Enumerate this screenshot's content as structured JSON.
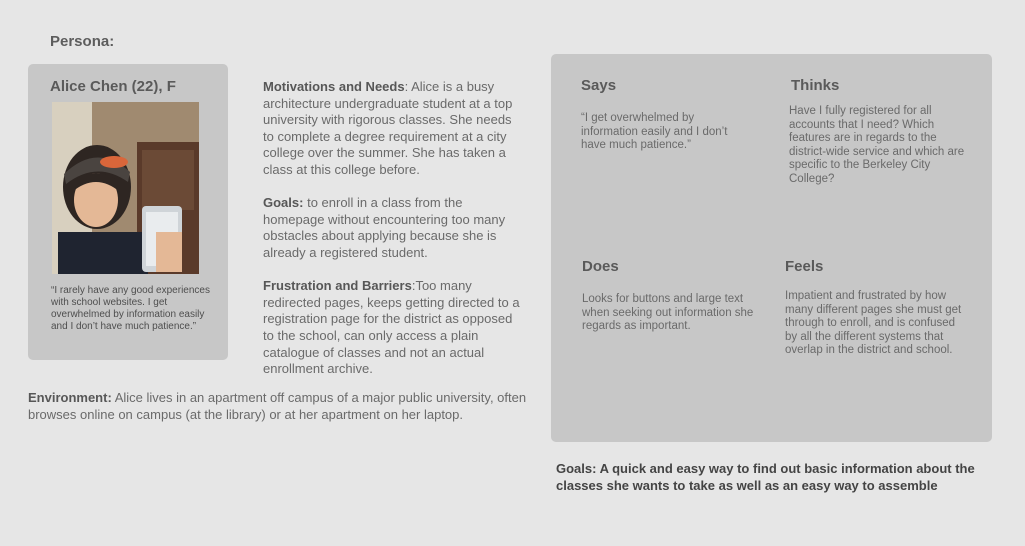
{
  "persona_label": "Persona:",
  "card": {
    "name": "Alice Chen (22), F",
    "quote": "“I rarely have any good experiences with school websites. I get overwhelmed by information easily and I don’t have much patience.”"
  },
  "sections": {
    "motivations": {
      "heading": "Motivations and Needs",
      "text": ": Alice is a busy architecture undergraduate student at a top university with rigorous classes. She needs to complete a degree requirement at a city college over the summer. She has taken a class at this college before."
    },
    "goals": {
      "heading": "Goals:",
      "text": " to enroll in a class from the homepage without encountering too many obstacles about applying because she is already a registered student."
    },
    "frustrations": {
      "heading": "Frustration and Barriers",
      "text": ":Too many redirected pages, keeps getting directed to a registration page for the district as opposed to the school, can only access a plain catalogue of classes and not an actual enrollment archive."
    },
    "environment": {
      "heading": "Environment:",
      "text": " Alice lives in an apartment off campus of a major public university, often browses online on campus (at the library) or at her apartment on her laptop."
    }
  },
  "empathy_map": {
    "says": {
      "title": "Says",
      "text": "“I get overwhelmed by information easily and I don’t have much patience.”"
    },
    "thinks": {
      "title": "Thinks",
      "text": "Have I fully registered for all accounts that I need? Which features are in regards to the district-wide service and which are specific to the Berkeley City College?"
    },
    "does": {
      "title": "Does",
      "text": "Looks for buttons and large text when seeking out information she regards as important."
    },
    "feels": {
      "title": "Feels",
      "text": "Impatient and frustrated by how many different pages she must get through to enroll, and is confused by all the different systems that overlap in the district and school."
    }
  },
  "bottom_goals": "Goals:  A quick and easy way to find out basic information about the classes she wants to take as well as an easy way to assemble"
}
